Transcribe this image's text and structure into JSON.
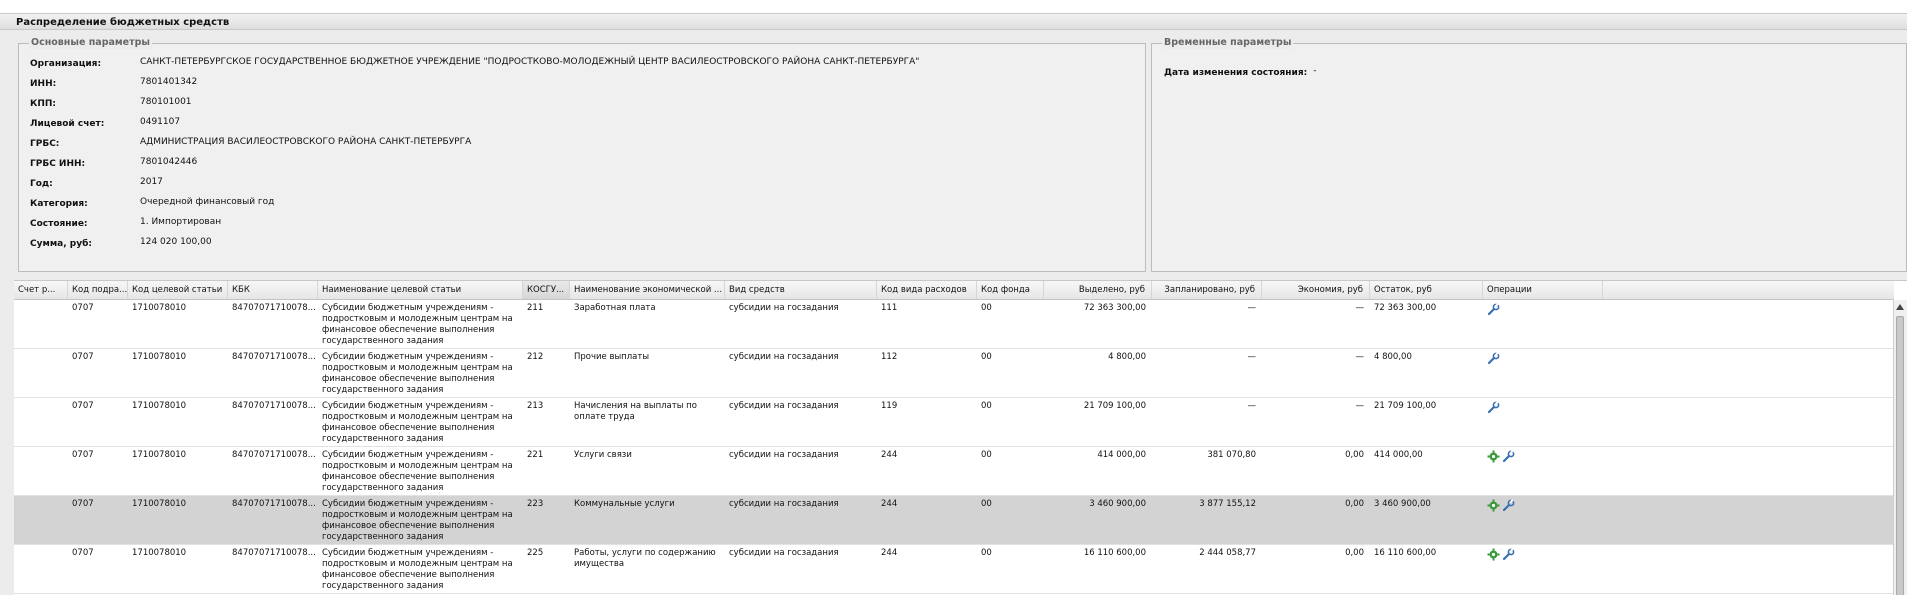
{
  "panel": {
    "title": "Распределение бюджетных средств"
  },
  "main_params": {
    "legend": "Основные параметры",
    "fields": [
      {
        "label": "Организация:",
        "value": "САНКТ-ПЕТЕРБУРГСКОЕ ГОСУДАРСТВЕННОЕ БЮДЖЕТНОЕ УЧРЕЖДЕНИЕ \"ПОДРОСТКОВО-МОЛОДЕЖНЫЙ ЦЕНТР ВАСИЛЕОСТРОВСКОГО РАЙОНА САНКТ-ПЕТЕРБУРГА\""
      },
      {
        "label": "ИНН:",
        "value": "7801401342"
      },
      {
        "label": "КПП:",
        "value": "780101001"
      },
      {
        "label": "Лицевой счет:",
        "value": "0491107"
      },
      {
        "label": "ГРБС:",
        "value": "АДМИНИСТРАЦИЯ ВАСИЛЕОСТРОВСКОГО РАЙОНА САНКТ-ПЕТЕРБУРГА"
      },
      {
        "label": "ГРБС ИНН:",
        "value": "7801042446"
      },
      {
        "label": "Год:",
        "value": "2017"
      },
      {
        "label": "Категория:",
        "value": "Очередной финансовый год"
      },
      {
        "label": "Состояние:",
        "value": "1. Импортирован"
      },
      {
        "label": "Сумма, руб:",
        "value": "124 020 100,00"
      }
    ]
  },
  "time_params": {
    "legend": "Временные параметры",
    "field": {
      "label": "Дата изменения состояния:",
      "value": "-"
    }
  },
  "table": {
    "columns": [
      "Счет р...",
      "Код подра...",
      "Код целевой статьи",
      "КБК",
      "Наименование целевой статьи",
      "КОСГУ...",
      "Наименование экономической ...",
      "Вид средств",
      "Код вида расходов",
      "Код фонда",
      "Выделено, руб",
      "Запланировано, руб",
      "Экономия, руб",
      "Остаток, руб",
      "Операции"
    ],
    "rows": [
      {
        "acct": "",
        "dept": "0707",
        "target_code": "1710078010",
        "kbk": "84707071710078...",
        "target_name": "Субсидии бюджетным учреждениям - подростковым и молодежным центрам на финансовое обеспечение выполнения государственного задания",
        "kosgu": "211",
        "econ_name": "Заработная плата",
        "fund_type": "субсидии на госзадания",
        "exp_code": "111",
        "fund_code": "00",
        "allocated": "72 363 300,00",
        "planned": "—",
        "economy": "—",
        "remainder": "72 363 300,00",
        "ops": [
          "wrench-icon"
        ]
      },
      {
        "acct": "",
        "dept": "0707",
        "target_code": "1710078010",
        "kbk": "84707071710078...",
        "target_name": "Субсидии бюджетным учреждениям - подростковым и молодежным центрам на финансовое обеспечение выполнения государственного задания",
        "kosgu": "212",
        "econ_name": "Прочие выплаты",
        "fund_type": "субсидии на госзадания",
        "exp_code": "112",
        "fund_code": "00",
        "allocated": "4 800,00",
        "planned": "—",
        "economy": "—",
        "remainder": "4 800,00",
        "ops": [
          "wrench-icon"
        ]
      },
      {
        "acct": "",
        "dept": "0707",
        "target_code": "1710078010",
        "kbk": "84707071710078...",
        "target_name": "Субсидии бюджетным учреждениям - подростковым и молодежным центрам на финансовое обеспечение выполнения государственного задания",
        "kosgu": "213",
        "econ_name": "Начисления на выплаты по оплате труда",
        "fund_type": "субсидии на госзадания",
        "exp_code": "119",
        "fund_code": "00",
        "allocated": "21 709 100,00",
        "planned": "—",
        "economy": "—",
        "remainder": "21 709 100,00",
        "ops": [
          "wrench-icon"
        ]
      },
      {
        "acct": "",
        "dept": "0707",
        "target_code": "1710078010",
        "kbk": "84707071710078...",
        "target_name": "Субсидии бюджетным учреждениям - подростковым и молодежным центрам на финансовое обеспечение выполнения государственного задания",
        "kosgu": "221",
        "econ_name": "Услуги связи",
        "fund_type": "субсидии на госзадания",
        "exp_code": "244",
        "fund_code": "00",
        "allocated": "414 000,00",
        "planned": "381 070,80",
        "economy": "0,00",
        "remainder": "414 000,00",
        "ops": [
          "gear-icon",
          "wrench-icon"
        ]
      },
      {
        "acct": "",
        "dept": "0707",
        "target_code": "1710078010",
        "kbk": "84707071710078...",
        "target_name": "Субсидии бюджетным учреждениям - подростковым и молодежным центрам на финансовое обеспечение выполнения государственного задания",
        "kosgu": "223",
        "econ_name": "Коммунальные услуги",
        "fund_type": "субсидии на госзадания",
        "exp_code": "244",
        "fund_code": "00",
        "allocated": "3 460 900,00",
        "planned": "3 877 155,12",
        "economy": "0,00",
        "remainder": "3 460 900,00",
        "ops": [
          "gear-icon",
          "wrench-icon"
        ],
        "selected": true
      },
      {
        "acct": "",
        "dept": "0707",
        "target_code": "1710078010",
        "kbk": "84707071710078...",
        "target_name": "Субсидии бюджетным учреждениям - подростковым и молодежным центрам на финансовое обеспечение выполнения государственного задания",
        "kosgu": "225",
        "econ_name": "Работы, услуги по содержанию имущества",
        "fund_type": "субсидии на госзадания",
        "exp_code": "244",
        "fund_code": "00",
        "allocated": "16 110 600,00",
        "planned": "2 444 058,77",
        "economy": "0,00",
        "remainder": "16 110 600,00",
        "ops": [
          "gear-icon",
          "wrench-icon"
        ]
      }
    ]
  },
  "colors": {
    "selected_row": "#d3d3d3",
    "wrench": "#3a6fb0",
    "gear": "#3a9a3a"
  }
}
